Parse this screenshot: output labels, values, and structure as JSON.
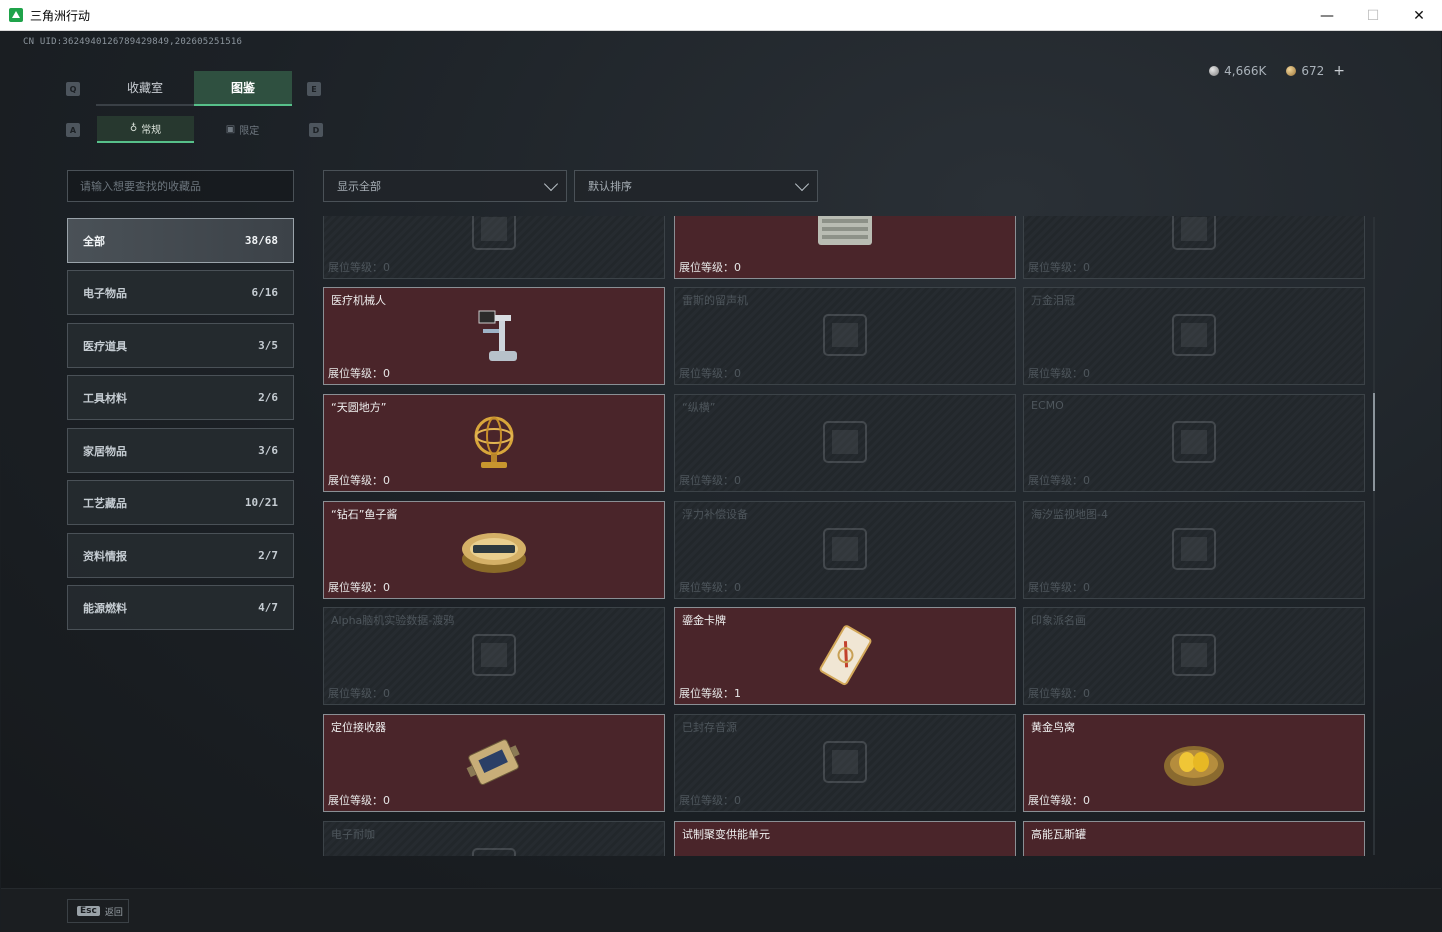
{
  "window": {
    "title": "三角洲行动",
    "minimize": "—",
    "maximize": "☐",
    "close": "✕"
  },
  "uid": "CN UID:362494012678942984​9,202605251516",
  "currency": {
    "silver": "4,666K",
    "gold": "672"
  },
  "key_hints": {
    "prev_main": "Q",
    "next_main": "E",
    "prev_sub": "A",
    "next_sub": "D"
  },
  "main_tabs": [
    {
      "label": "收藏室"
    },
    {
      "label": "图鉴"
    }
  ],
  "sub_tabs": [
    {
      "label": "常规"
    },
    {
      "label": "限定"
    }
  ],
  "search": {
    "placeholder": "请输入想要查找的收藏品"
  },
  "filters": {
    "show": "显示全部",
    "sort": "默认排序"
  },
  "categories": [
    {
      "label": "全部",
      "count": "38/68"
    },
    {
      "label": "电子物品",
      "count": "6/16"
    },
    {
      "label": "医疗道具",
      "count": "3/5"
    },
    {
      "label": "工具材料",
      "count": "2/6"
    },
    {
      "label": "家居物品",
      "count": "3/6"
    },
    {
      "label": "工艺藏品",
      "count": "10/21"
    },
    {
      "label": "资料情报",
      "count": "2/7"
    },
    {
      "label": "能源燃料",
      "count": "4/7"
    }
  ],
  "level_label": "展位等级：",
  "items": [
    {
      "name": "",
      "level": "0",
      "owned": false,
      "icon": "crate-icon"
    },
    {
      "name": "",
      "level": "0",
      "owned": true,
      "icon": "server-box-icon"
    },
    {
      "name": "",
      "level": "0",
      "owned": false,
      "icon": "crate-icon"
    },
    {
      "name": "医疗机械人",
      "level": "0",
      "owned": true,
      "icon": "medical-robot-icon"
    },
    {
      "name": "雷斯的留声机",
      "level": "0",
      "owned": false,
      "icon": "gramophone-icon"
    },
    {
      "name": "万金泪冠",
      "level": "0",
      "owned": false,
      "icon": "crown-icon"
    },
    {
      "name": "“天圆地方”",
      "level": "0",
      "owned": true,
      "icon": "armillary-sphere-icon"
    },
    {
      "name": "“纵横”",
      "level": "0",
      "owned": false,
      "icon": "chessboard-icon"
    },
    {
      "name": "ECMO",
      "level": "0",
      "owned": false,
      "icon": "ecmo-icon"
    },
    {
      "name": "“钻石”鱼子酱",
      "level": "0",
      "owned": true,
      "icon": "caviar-tin-icon"
    },
    {
      "name": "浮力补偿设备",
      "level": "0",
      "owned": false,
      "icon": "bcd-vest-icon"
    },
    {
      "name": "海汐监视地图-4",
      "level": "0",
      "owned": false,
      "icon": "map-icon"
    },
    {
      "name": "Alpha脑机实验数据-渡鸦",
      "level": "0",
      "owned": false,
      "icon": "data-device-icon"
    },
    {
      "name": "鎏金卡牌",
      "level": "1",
      "owned": true,
      "icon": "gilded-card-icon"
    },
    {
      "name": "印象派名画",
      "level": "0",
      "owned": false,
      "icon": "painting-icon"
    },
    {
      "name": "定位接收器",
      "level": "0",
      "owned": true,
      "icon": "gps-receiver-icon"
    },
    {
      "name": "已封存音源",
      "level": "0",
      "owned": false,
      "icon": "audio-source-icon"
    },
    {
      "name": "黄金鸟窝",
      "level": "0",
      "owned": true,
      "icon": "golden-nest-icon"
    },
    {
      "name": "电子耐咖",
      "level": "",
      "owned": false,
      "icon": "device-icon"
    },
    {
      "name": "试制聚变供能单元",
      "level": "",
      "owned": true,
      "icon": "fusion-unit-icon"
    },
    {
      "name": "高能瓦斯罐",
      "level": "",
      "owned": true,
      "icon": "gas-tank-icon"
    }
  ],
  "footer": {
    "esc_key": "Esc",
    "esc_label": "返回"
  }
}
